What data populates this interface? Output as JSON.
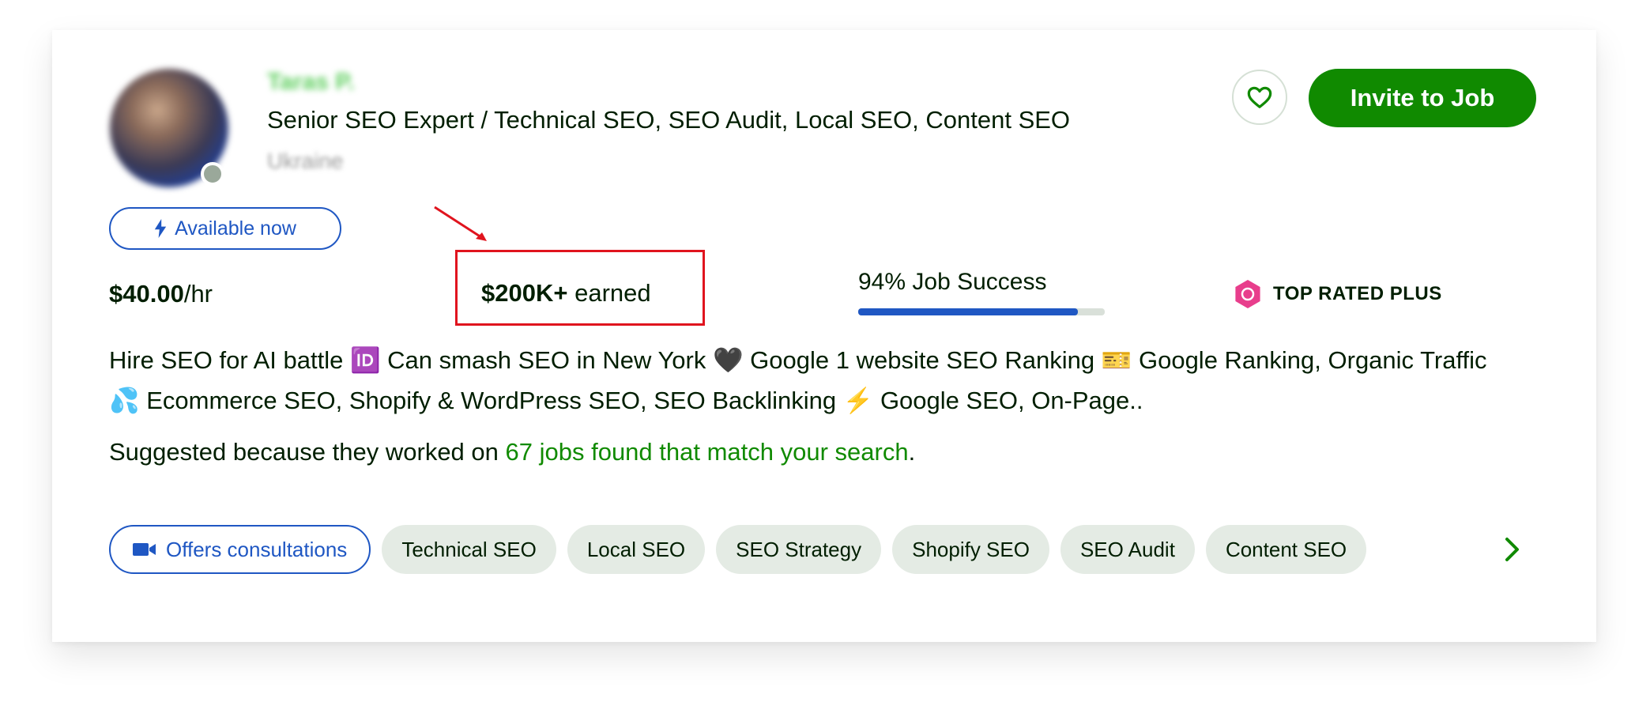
{
  "freelancer": {
    "name": "Taras P.",
    "headline": "Senior SEO Expert / Technical SEO, SEO Audit, Local SEO, Content SEO",
    "location": "Ukraine",
    "availability": "Available now",
    "rate_value": "$40.00",
    "rate_unit": "/hr",
    "earned_value": "$200K+",
    "earned_label": " earned",
    "job_success_label": "94% Job Success",
    "job_success_fraction": 0.89,
    "badge": "TOP RATED PLUS",
    "overview": "Hire SEO for AI battle 🆔 Can smash SEO in New York 🖤 Google 1 website SEO Ranking 🎫 Google Ranking, Organic Traffic 💦 Ecommerce SEO, Shopify & WordPress SEO, SEO Backlinking ⚡ Google SEO, On-Page..",
    "suggested_prefix": "Suggested because they worked on ",
    "suggested_link": "67 jobs found that match your search",
    "suggested_suffix": "."
  },
  "actions": {
    "save_icon": "heart-icon",
    "invite_label": "Invite to Job"
  },
  "skills": {
    "consultation_label": "Offers consultations",
    "chips": [
      "Technical SEO",
      "Local SEO",
      "SEO Strategy",
      "Shopify SEO",
      "SEO Audit",
      "Content SEO"
    ]
  },
  "colors": {
    "brand_green": "#108a00",
    "link_blue": "#1f57c3",
    "highlight_red": "#e0141e",
    "badge_pink": "#e83e8c",
    "chip_bg": "#e4ebe4"
  }
}
